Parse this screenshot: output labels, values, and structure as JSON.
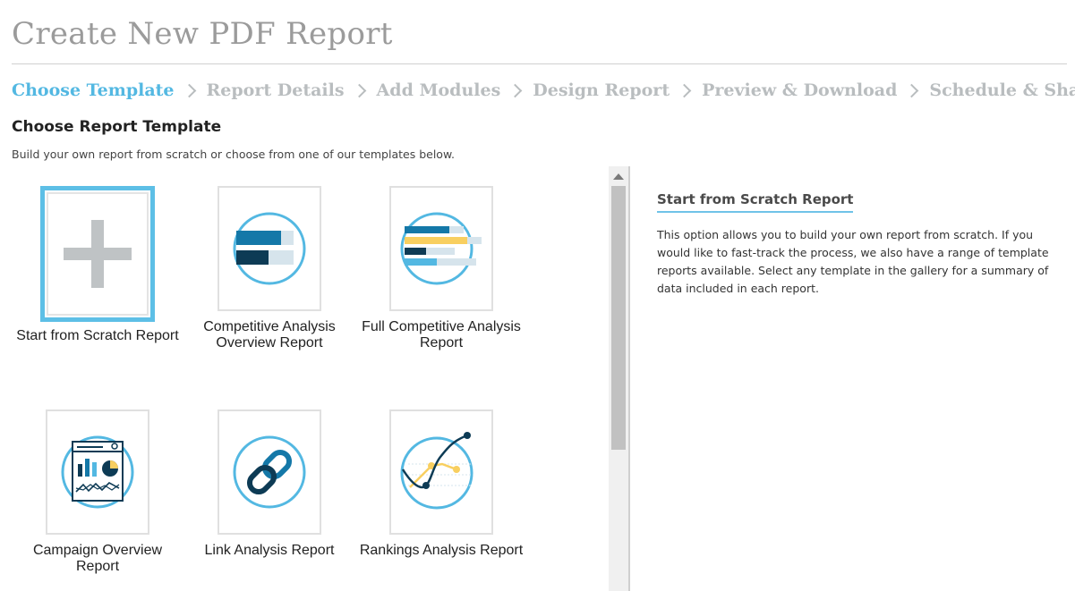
{
  "page": {
    "title": "Create New PDF Report"
  },
  "steps": [
    {
      "label": "Choose Template",
      "active": true
    },
    {
      "label": "Report Details"
    },
    {
      "label": "Add Modules"
    },
    {
      "label": "Design Report"
    },
    {
      "label": "Preview & Download"
    },
    {
      "label": "Schedule & Share"
    }
  ],
  "section": {
    "title": "Choose Report Template",
    "description": "Build your own report from scratch or choose from one of our templates below."
  },
  "templates": [
    {
      "label": "Start from Scratch Report",
      "icon": "plus-icon",
      "selected": true
    },
    {
      "label": "Competitive Analysis Overview Report",
      "icon": "bar-chart-icon"
    },
    {
      "label": "Full Competitive Analysis Report",
      "icon": "multi-bar-chart-icon"
    },
    {
      "label": "Campaign Overview Report",
      "icon": "dashboard-icon"
    },
    {
      "label": "Link Analysis Report",
      "icon": "link-icon"
    },
    {
      "label": "Rankings Analysis Report",
      "icon": "line-chart-icon"
    }
  ],
  "detail": {
    "title": "Start from Scratch Report",
    "text": "This option allows you to build your own report from scratch. If you would like to fast-track the process, we also have a range of template reports available. Select any template in the gallery for a summary of data included in each report."
  },
  "colors": {
    "accent": "#53b8e2",
    "navy": "#0d3b55",
    "blue": "#1478a8",
    "yellow": "#f8cf60",
    "light": "#d6e4ec"
  }
}
